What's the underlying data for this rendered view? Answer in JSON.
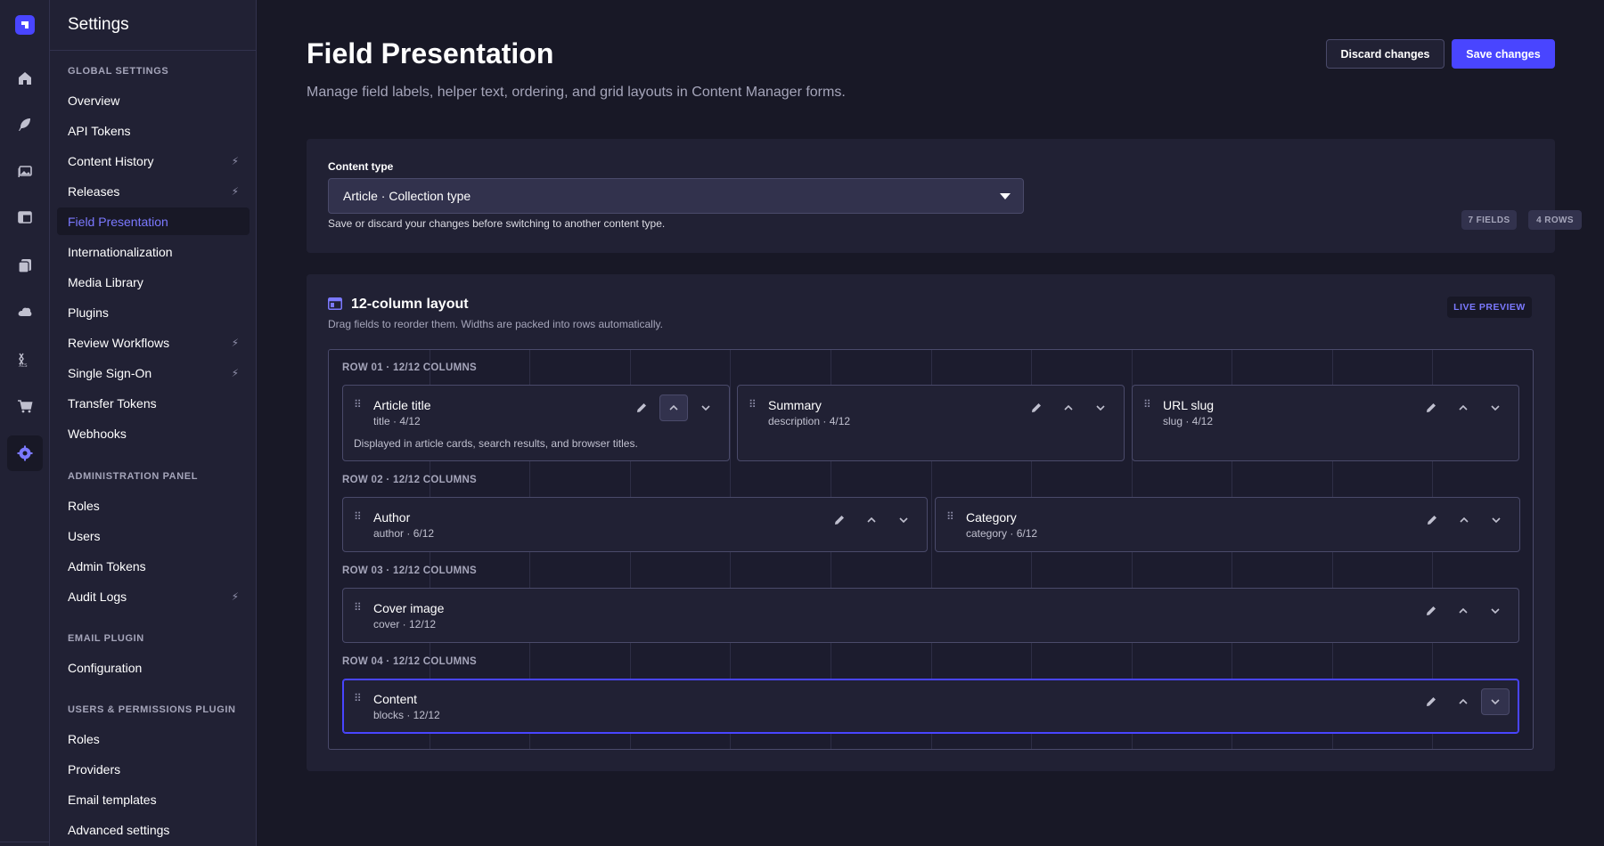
{
  "sidebar": {
    "title": "Settings",
    "sections": [
      {
        "title": "GLOBAL SETTINGS",
        "items": [
          {
            "label": "Overview",
            "bolt": false
          },
          {
            "label": "API Tokens",
            "bolt": false
          },
          {
            "label": "Content History",
            "bolt": true
          },
          {
            "label": "Releases",
            "bolt": true
          },
          {
            "label": "Field Presentation",
            "bolt": false,
            "active": true
          },
          {
            "label": "Internationalization",
            "bolt": false
          },
          {
            "label": "Media Library",
            "bolt": false
          },
          {
            "label": "Plugins",
            "bolt": false
          },
          {
            "label": "Review Workflows",
            "bolt": true
          },
          {
            "label": "Single Sign-On",
            "bolt": true
          },
          {
            "label": "Transfer Tokens",
            "bolt": false
          },
          {
            "label": "Webhooks",
            "bolt": false
          }
        ]
      },
      {
        "title": "ADMINISTRATION PANEL",
        "items": [
          {
            "label": "Roles",
            "bolt": false
          },
          {
            "label": "Users",
            "bolt": false
          },
          {
            "label": "Admin Tokens",
            "bolt": false
          },
          {
            "label": "Audit Logs",
            "bolt": true
          }
        ]
      },
      {
        "title": "EMAIL PLUGIN",
        "items": [
          {
            "label": "Configuration",
            "bolt": false
          }
        ]
      },
      {
        "title": "USERS & PERMISSIONS PLUGIN",
        "items": [
          {
            "label": "Roles",
            "bolt": false
          },
          {
            "label": "Providers",
            "bolt": false
          },
          {
            "label": "Email templates",
            "bolt": false
          },
          {
            "label": "Advanced settings",
            "bolt": false
          }
        ]
      }
    ],
    "bolt_glyph": "⚡"
  },
  "rail_icons": [
    "home-icon",
    "feather-icon",
    "media-icon",
    "layout-icon",
    "pages-icon",
    "cloud-icon",
    "xls-icon",
    "cart-icon",
    "settings-icon"
  ],
  "header": {
    "title": "Field Presentation",
    "subtitle": "Manage field labels, helper text, ordering, and grid layouts in Content Manager forms.",
    "discard_label": "Discard changes",
    "save_label": "Save changes"
  },
  "content_type": {
    "label": "Content type",
    "selected": "Article · Collection type",
    "hint": "Save or discard your changes before switching to another content type.",
    "fields_badge": "7 FIELDS",
    "rows_badge": "4 ROWS"
  },
  "layout": {
    "title": "12-column layout",
    "subtitle": "Drag fields to reorder them. Widths are packed into rows automatically.",
    "live_badge": "LIVE PREVIEW",
    "rows": [
      {
        "label": "ROW 01 · 12/12 COLUMNS",
        "fields": [
          {
            "name": "Article title",
            "meta": "title · 4/12",
            "help": "Displayed in article cards, search results, and browser titles.",
            "span": 4
          },
          {
            "name": "Summary",
            "meta": "description · 4/12",
            "help": "",
            "span": 4
          },
          {
            "name": "URL slug",
            "meta": "slug · 4/12",
            "help": "",
            "span": 4
          }
        ]
      },
      {
        "label": "ROW 02 · 12/12 COLUMNS",
        "fields": [
          {
            "name": "Author",
            "meta": "author · 6/12",
            "help": "",
            "span": 6
          },
          {
            "name": "Category",
            "meta": "category · 6/12",
            "help": "",
            "span": 6
          }
        ]
      },
      {
        "label": "ROW 03 · 12/12 COLUMNS",
        "fields": [
          {
            "name": "Cover image",
            "meta": "cover · 12/12",
            "help": "",
            "span": 12
          }
        ]
      },
      {
        "label": "ROW 04 · 12/12 COLUMNS",
        "fields": [
          {
            "name": "Content",
            "meta": "blocks · 12/12",
            "help": "",
            "span": 12,
            "selected": true
          }
        ]
      }
    ]
  },
  "colors": {
    "accent": "#4945ff",
    "accent_text": "#7b79ff",
    "background": "#181826",
    "panel": "#212134",
    "border": "#4a4a6a"
  }
}
